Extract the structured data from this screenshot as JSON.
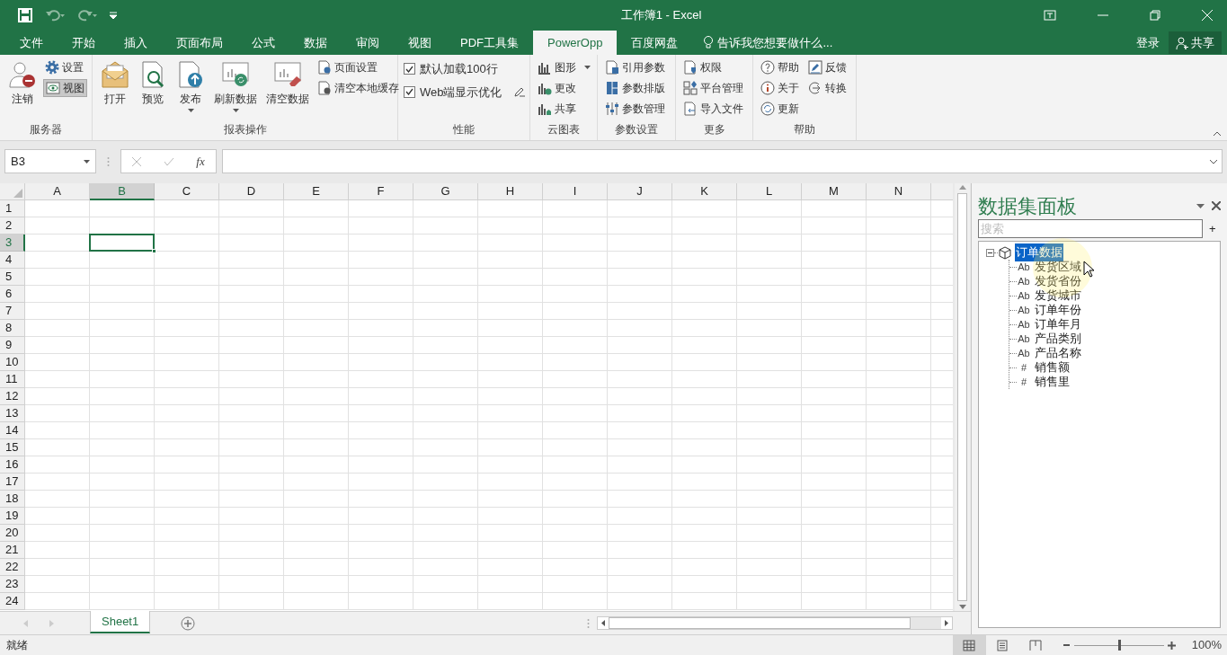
{
  "window": {
    "title": "工作簿1 - Excel"
  },
  "tabs": [
    {
      "label": "文件",
      "selected": false
    },
    {
      "label": "开始",
      "selected": false
    },
    {
      "label": "插入",
      "selected": false
    },
    {
      "label": "页面布局",
      "selected": false
    },
    {
      "label": "公式",
      "selected": false
    },
    {
      "label": "数据",
      "selected": false
    },
    {
      "label": "审阅",
      "selected": false
    },
    {
      "label": "视图",
      "selected": false
    },
    {
      "label": "PDF工具集",
      "selected": false
    },
    {
      "label": "PowerOpp",
      "selected": true
    },
    {
      "label": "百度网盘",
      "selected": false
    }
  ],
  "tell_me": {
    "placeholder": "告诉我您想要做什么..."
  },
  "account": {
    "login": "登录",
    "share": "共享"
  },
  "ribbon": {
    "groups": [
      {
        "name": "服务器",
        "items": [
          {
            "label": "注销",
            "kind": "large"
          },
          {
            "label": "设置",
            "kind": "small",
            "pressed": false
          },
          {
            "label": "视图",
            "kind": "small",
            "pressed": true
          }
        ]
      },
      {
        "name": "报表操作",
        "items": [
          {
            "label": "打开",
            "kind": "large",
            "dropdown": false
          },
          {
            "label": "预览",
            "kind": "large",
            "dropdown": false
          },
          {
            "label": "发布",
            "kind": "large",
            "dropdown": true
          },
          {
            "label": "刷新数据",
            "kind": "large",
            "dropdown": true
          },
          {
            "label": "清空数据",
            "kind": "large",
            "dropdown": false
          },
          {
            "label": "页面设置",
            "kind": "small",
            "dropdown": false
          },
          {
            "label": "清空本地缓存",
            "kind": "small",
            "dropdown": false
          }
        ]
      },
      {
        "name": "性能",
        "items": [
          {
            "label": "默认加载100行",
            "kind": "check",
            "checked": true
          },
          {
            "label": "Web端显示优化",
            "kind": "check",
            "checked": true
          }
        ]
      },
      {
        "name": "云图表",
        "items": [
          {
            "label": "图形",
            "kind": "small",
            "dropdown": true
          },
          {
            "label": "更改",
            "kind": "small",
            "dropdown": false
          },
          {
            "label": "共享",
            "kind": "small",
            "dropdown": false
          }
        ]
      },
      {
        "name": "参数设置",
        "items": [
          {
            "label": "引用参数",
            "kind": "small"
          },
          {
            "label": "参数排版",
            "kind": "small"
          },
          {
            "label": "参数管理",
            "kind": "small"
          }
        ]
      },
      {
        "name": "更多",
        "items": [
          {
            "label": "权限",
            "kind": "small"
          },
          {
            "label": "平台管理",
            "kind": "small"
          },
          {
            "label": "导入文件",
            "kind": "small"
          }
        ]
      },
      {
        "name": "帮助",
        "items": [
          {
            "label": "帮助",
            "kind": "small"
          },
          {
            "label": "关于",
            "kind": "small"
          },
          {
            "label": "更新",
            "kind": "small"
          },
          {
            "label": "反馈",
            "kind": "small"
          },
          {
            "label": "转换",
            "kind": "small"
          }
        ]
      }
    ]
  },
  "formula_bar": {
    "name_box": "B3",
    "function_label": "fx"
  },
  "grid": {
    "columns": [
      {
        "label": "A",
        "selected": false
      },
      {
        "label": "B",
        "selected": true
      },
      {
        "label": "C",
        "selected": false
      },
      {
        "label": "D",
        "selected": false
      },
      {
        "label": "E",
        "selected": false
      },
      {
        "label": "F",
        "selected": false
      },
      {
        "label": "G",
        "selected": false
      },
      {
        "label": "H",
        "selected": false
      },
      {
        "label": "I",
        "selected": false
      },
      {
        "label": "J",
        "selected": false
      },
      {
        "label": "K",
        "selected": false
      },
      {
        "label": "L",
        "selected": false
      },
      {
        "label": "M",
        "selected": false
      },
      {
        "label": "N",
        "selected": false
      }
    ],
    "rows": [
      {
        "label": "1",
        "selected": false
      },
      {
        "label": "2",
        "selected": false
      },
      {
        "label": "3",
        "selected": true
      },
      {
        "label": "4",
        "selected": false
      },
      {
        "label": "5",
        "selected": false
      },
      {
        "label": "6",
        "selected": false
      },
      {
        "label": "7",
        "selected": false
      },
      {
        "label": "8",
        "selected": false
      },
      {
        "label": "9",
        "selected": false
      },
      {
        "label": "10",
        "selected": false
      },
      {
        "label": "11",
        "selected": false
      },
      {
        "label": "12",
        "selected": false
      },
      {
        "label": "13",
        "selected": false
      },
      {
        "label": "14",
        "selected": false
      },
      {
        "label": "15",
        "selected": false
      },
      {
        "label": "16",
        "selected": false
      },
      {
        "label": "17",
        "selected": false
      },
      {
        "label": "18",
        "selected": false
      },
      {
        "label": "19",
        "selected": false
      },
      {
        "label": "20",
        "selected": false
      },
      {
        "label": "21",
        "selected": false
      },
      {
        "label": "22",
        "selected": false
      },
      {
        "label": "23",
        "selected": false
      },
      {
        "label": "24",
        "selected": false
      }
    ]
  },
  "sheets": [
    {
      "label": "Sheet1",
      "selected": true
    }
  ],
  "panel": {
    "title": "数据集面板",
    "search": {
      "placeholder": "搜索"
    },
    "add": "+",
    "tree": [
      {
        "label": "订单数据",
        "selected": true,
        "expanded": true,
        "children": [
          {
            "glyph": "Ab",
            "label": "发货区域"
          },
          {
            "glyph": "Ab",
            "label": "发货省份"
          },
          {
            "glyph": "Ab",
            "label": "发货城市"
          },
          {
            "glyph": "Ab",
            "label": "订单年份"
          },
          {
            "glyph": "Ab",
            "label": "订单年月"
          },
          {
            "glyph": "Ab",
            "label": "产品类别"
          },
          {
            "glyph": "Ab",
            "label": "产品名称"
          },
          {
            "glyph": "#",
            "label": "销售额"
          },
          {
            "glyph": "#",
            "label": "销售里"
          }
        ]
      }
    ]
  },
  "status_bar": {
    "text": "就绪",
    "views": [
      {
        "selected": true
      },
      {
        "selected": false
      },
      {
        "selected": false
      }
    ],
    "zoom": {
      "level": 0.5,
      "reading": "100%"
    }
  }
}
